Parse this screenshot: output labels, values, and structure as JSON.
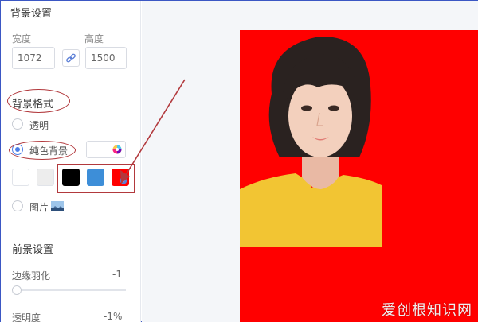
{
  "panel": {
    "background_settings_title": "背景设置",
    "width_label": "宽度",
    "height_label": "高度",
    "width_value": "1072",
    "height_value": "1500",
    "bg_format_title": "背景格式",
    "transparent_label": "透明",
    "solid_bg_label": "纯色背景",
    "image_label": "图片",
    "foreground_title": "前景设置",
    "edge_feather_label": "边缘羽化",
    "edge_feather_value": "-1",
    "opacity_label": "透明度",
    "opacity_value": "-1%",
    "swatches": [
      {
        "name": "white",
        "color": "#ffffff"
      },
      {
        "name": "light-gray",
        "color": "#ededed"
      },
      {
        "name": "black",
        "color": "#000000"
      },
      {
        "name": "blue",
        "color": "#3d8ed8"
      },
      {
        "name": "red",
        "color": "#ff0000"
      }
    ]
  },
  "canvas": {
    "background_color": "#ff0000",
    "shirt_color": "#f2c533",
    "skin_color": "#f3d0bd",
    "hair_color": "#2a2220"
  },
  "watermark": "爱创根知识网",
  "icons": [
    "link-icon",
    "color-wheel-icon",
    "image-thumbnail-icon",
    "arrow-icon"
  ]
}
